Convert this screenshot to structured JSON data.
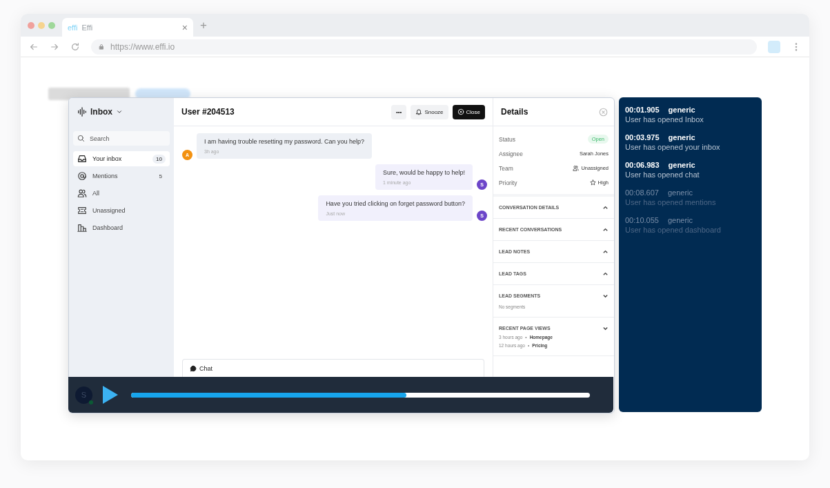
{
  "browser": {
    "tab_logo": "effi",
    "tab_title": "Effi",
    "close": "×",
    "new_tab": "+",
    "url": "https://www.effi.io"
  },
  "sidebar": {
    "title": "Inbox",
    "search": {
      "placeholder": "Search"
    },
    "items": [
      {
        "label": "Your inbox",
        "count": "10",
        "selected": true
      },
      {
        "label": "Mentions",
        "count": "5",
        "selected": false
      },
      {
        "label": "All",
        "selected": false
      },
      {
        "label": "Unassigned",
        "selected": false
      },
      {
        "label": "Dashboard",
        "selected": false
      }
    ]
  },
  "conversation": {
    "title": "User #204513",
    "buttons": [
      {
        "label": "•••",
        "kind": "more"
      },
      {
        "label": "Snooze",
        "kind": "snooze"
      },
      {
        "label": "Close",
        "kind": "close"
      }
    ],
    "messages": [
      {
        "text": "I am having trouble resetting my password. Can you help?",
        "time": "3h ago",
        "kind": "incoming",
        "avatar": "A",
        "color": "#f39212"
      },
      {
        "text": "Sure, would be happy to help!",
        "time": "1 minute ago",
        "kind": "outgoing",
        "avatar": "S",
        "color": "#6c45c9"
      },
      {
        "text": "Have you tried clicking on forget password button?",
        "time": "Just now",
        "kind": "outgoing",
        "avatar": "S",
        "color": "#6c45c9"
      }
    ],
    "composer": {
      "tab": "Chat"
    }
  },
  "details": {
    "title": "Details",
    "fields": [
      {
        "label": "Status",
        "value": "Open",
        "kind": "badge"
      },
      {
        "label": "Assignee",
        "value": "Sarah Jones",
        "kind": "text"
      },
      {
        "label": "Team",
        "value": "Unassigned",
        "kind": "team"
      },
      {
        "label": "Priority",
        "value": "High",
        "kind": "priority"
      }
    ],
    "sections": [
      {
        "title": "CONVERSATION DETAILS",
        "expanded": true
      },
      {
        "title": "RECENT CONVERSATIONS",
        "expanded": true
      },
      {
        "title": "LEAD NOTES",
        "expanded": true
      },
      {
        "title": "LEAD TAGS",
        "expanded": true
      },
      {
        "title": "LEAD SEGMENTS",
        "expanded": false,
        "note": "No segments"
      },
      {
        "title": "RECENT PAGE VIEWS",
        "expanded": false,
        "views": [
          {
            "time": "3 hours ago",
            "separator": "•",
            "page": "Homepage"
          },
          {
            "time": "12 hours ago",
            "separator": "•",
            "page": "Pricing"
          }
        ]
      }
    ]
  },
  "player": {
    "avatar": "S",
    "level": 0.6
  },
  "log": [
    {
      "time": "00:01.905",
      "type": "generic",
      "text": "User has opened Inbox",
      "active": true
    },
    {
      "time": "00:03.975",
      "type": "generic",
      "text": "User has opened your inbox",
      "active": true
    },
    {
      "time": "00:06.983",
      "type": "generic",
      "text": "User has opened chat",
      "active": true
    },
    {
      "time": "00:08.607",
      "type": "generic",
      "text": "User has opened mentions",
      "active": false
    },
    {
      "time": "00:10.055",
      "type": "generic",
      "text": "User has opened dashboard",
      "active": false
    }
  ]
}
